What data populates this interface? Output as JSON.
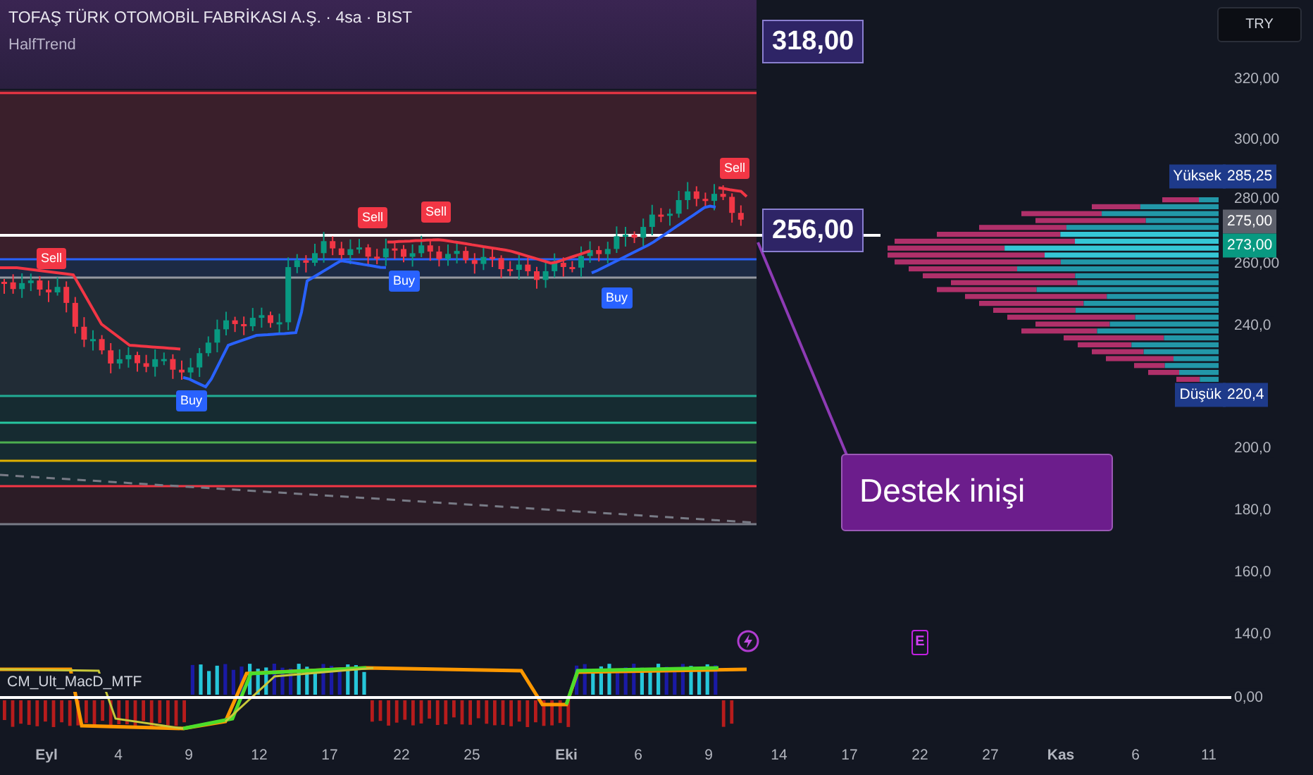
{
  "header": {
    "symbol_line": "TOFAŞ TÜRK OTOMOBİL FABRİKASI A.Ş. · 4sa · BIST",
    "indicator": "HalfTrend"
  },
  "currency_button": "TRY",
  "price_axis": [
    "320,00",
    "300,00",
    "280,00",
    "260,00",
    "240,0",
    "200,0",
    "180,0",
    "160,0",
    "140,0"
  ],
  "price_tags": [
    {
      "label": "Yüksek",
      "value": "285,25",
      "kind": "high"
    },
    {
      "value": "275,00",
      "kind": "last"
    },
    {
      "value": "273,00",
      "kind": "current"
    },
    {
      "label": "Düşük",
      "value": "220,4",
      "kind": "low"
    }
  ],
  "signals": [
    {
      "text": "Sell",
      "kind": "sell"
    },
    {
      "text": "Sell",
      "kind": "sell"
    },
    {
      "text": "Sell",
      "kind": "sell"
    },
    {
      "text": "Sell",
      "kind": "sell"
    },
    {
      "text": "Buy",
      "kind": "buy"
    },
    {
      "text": "Buy",
      "kind": "buy"
    },
    {
      "text": "Buy",
      "kind": "buy"
    }
  ],
  "callouts": [
    "318,00",
    "256,00"
  ],
  "annotation": "Destek inişi",
  "oscillator": {
    "name": "CM_Ult_MacD_MTF",
    "axis_label": "0,00",
    "event_marker": "E"
  },
  "time_axis": [
    "Eyl",
    "4",
    "9",
    "12",
    "17",
    "22",
    "25",
    "Eki",
    "6",
    "9",
    "14",
    "17",
    "22",
    "27",
    "Kas",
    "6",
    "11"
  ]
}
